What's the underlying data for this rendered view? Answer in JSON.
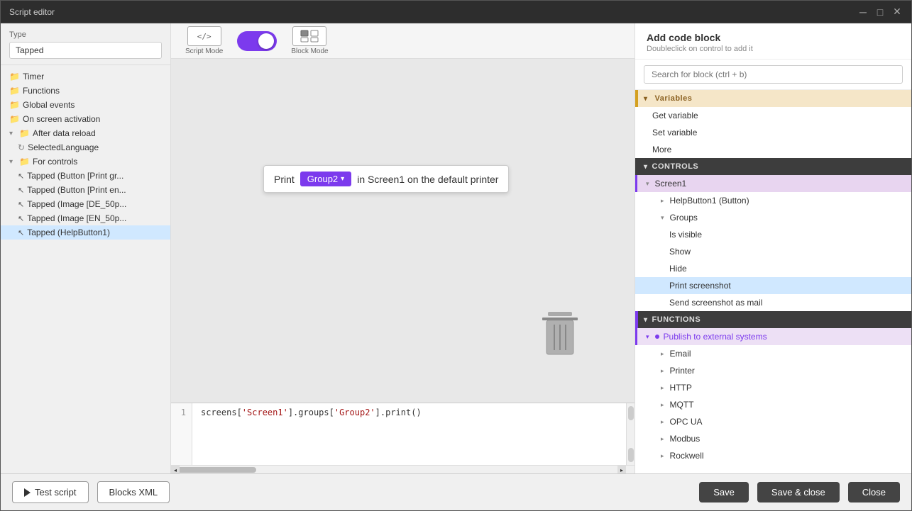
{
  "window": {
    "title": "Script editor"
  },
  "titlebar": {
    "title": "Script editor",
    "minimize_label": "─",
    "maximize_label": "□",
    "close_label": "✕"
  },
  "left_panel": {
    "type_label": "Type",
    "type_value": "Tapped",
    "tree_items": [
      {
        "id": "timer",
        "label": "Timer",
        "icon": "folder",
        "indent": 0
      },
      {
        "id": "functions",
        "label": "Functions",
        "icon": "folder",
        "indent": 0
      },
      {
        "id": "global_events",
        "label": "Global events",
        "icon": "folder",
        "indent": 0
      },
      {
        "id": "on_screen_activation",
        "label": "On screen activation",
        "icon": "folder",
        "indent": 0
      },
      {
        "id": "after_data_reload",
        "label": "After data reload",
        "icon": "folder",
        "indent": 0,
        "expanded": true
      },
      {
        "id": "selected_language",
        "label": "SelectedLanguage",
        "icon": "file",
        "indent": 1
      },
      {
        "id": "for_controls",
        "label": "For controls",
        "icon": "folder",
        "indent": 0,
        "expanded": true
      },
      {
        "id": "tapped_btn_print1",
        "label": "Tapped (Button [Print gr...",
        "icon": "cursor",
        "indent": 1
      },
      {
        "id": "tapped_btn_print2",
        "label": "Tapped (Button [Print en...",
        "icon": "cursor",
        "indent": 1
      },
      {
        "id": "tapped_img_de",
        "label": "Tapped (Image [DE_50p...",
        "icon": "cursor",
        "indent": 1
      },
      {
        "id": "tapped_img_en",
        "label": "Tapped (Image [EN_50p...",
        "icon": "cursor",
        "indent": 1
      },
      {
        "id": "tapped_helpbutton1",
        "label": "Tapped (HelpButton1)",
        "icon": "cursor",
        "indent": 1,
        "selected": true
      }
    ]
  },
  "center": {
    "script_mode_label": "Script Mode",
    "block_mode_label": "Block Mode",
    "script_mode_icon": "</>",
    "block_mode_icon": "⊞",
    "print_block": {
      "print_text": "Print",
      "group2_label": "Group2",
      "suffix_text": "in Screen1 on the default printer"
    },
    "code_line": "screens['Screen1'].groups['Group2'].print()",
    "line_number": "1"
  },
  "right_panel": {
    "add_code_title": "Add code block",
    "add_code_subtitle": "Doubleclick on control to add it",
    "search_placeholder": "Search for block (ctrl + b)",
    "sections": [
      {
        "id": "variables",
        "label": "Variables",
        "style": "variables",
        "items": [
          {
            "id": "get_variable",
            "label": "Get variable",
            "indent": 0
          },
          {
            "id": "set_variable",
            "label": "Set variable",
            "indent": 0
          },
          {
            "id": "more",
            "label": "More",
            "indent": 0
          }
        ]
      },
      {
        "id": "controls",
        "label": "CONTROLS",
        "style": "dark",
        "items": [
          {
            "id": "screen1",
            "label": "Screen1",
            "indent": 0,
            "selected": true,
            "chevron": "down"
          },
          {
            "id": "helpbutton1",
            "label": "HelpButton1 (Button)",
            "indent": 1,
            "chevron": "right"
          },
          {
            "id": "groups",
            "label": "Groups",
            "indent": 1,
            "chevron": "down"
          },
          {
            "id": "is_visible",
            "label": "Is visible",
            "indent": 2
          },
          {
            "id": "show",
            "label": "Show",
            "indent": 2
          },
          {
            "id": "hide",
            "label": "Hide",
            "indent": 2
          },
          {
            "id": "print_screenshot",
            "label": "Print screenshot",
            "indent": 2,
            "highlighted": true
          },
          {
            "id": "send_screenshot",
            "label": "Send screenshot as mail",
            "indent": 2
          }
        ]
      },
      {
        "id": "functions",
        "label": "FUNCTIONS",
        "style": "dark",
        "items": [
          {
            "id": "publish_external",
            "label": "Publish to external systems",
            "indent": 0,
            "selected": true,
            "chevron": "down",
            "purple_dot": true
          },
          {
            "id": "email",
            "label": "Email",
            "indent": 1,
            "chevron": "right"
          },
          {
            "id": "printer",
            "label": "Printer",
            "indent": 1,
            "chevron": "right"
          },
          {
            "id": "http",
            "label": "HTTP",
            "indent": 1,
            "chevron": "right"
          },
          {
            "id": "mqtt",
            "label": "MQTT",
            "indent": 1,
            "chevron": "right"
          },
          {
            "id": "opc_ua",
            "label": "OPC UA",
            "indent": 1,
            "chevron": "right"
          },
          {
            "id": "modbus",
            "label": "Modbus",
            "indent": 1,
            "chevron": "right"
          },
          {
            "id": "rockwell",
            "label": "Rockwell",
            "indent": 1,
            "chevron": "right"
          }
        ]
      }
    ]
  },
  "bottom_bar": {
    "test_script_label": "Test script",
    "blocks_xml_label": "Blocks XML",
    "save_label": "Save",
    "save_close_label": "Save & close",
    "close_label": "Close"
  }
}
